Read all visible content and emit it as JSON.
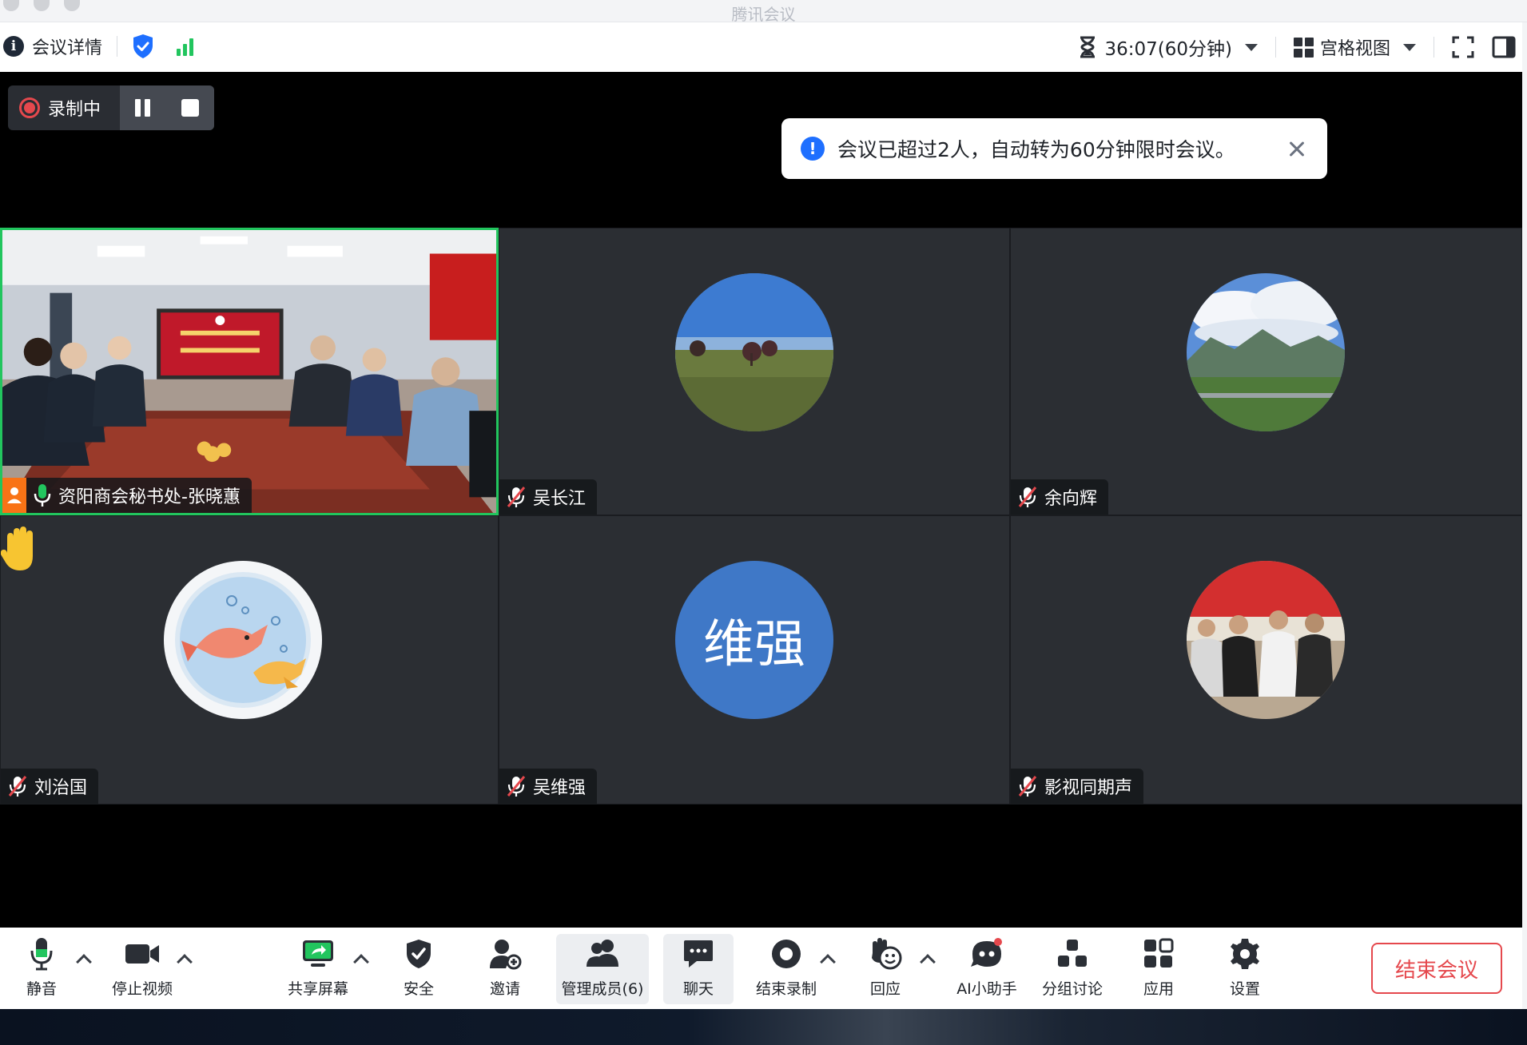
{
  "window": {
    "title": "腾讯会议"
  },
  "infobar": {
    "details_label": "会议详情",
    "timer": "36:07(60分钟)",
    "view_label": "宫格视图"
  },
  "recording": {
    "status_label": "录制中"
  },
  "toast": {
    "message": "会议已超过2人，自动转为60分钟限时会议。"
  },
  "participants": [
    {
      "name": "资阳商会秘书处-张晓蕙",
      "mic": "on",
      "video": "on",
      "active_speaker": true
    },
    {
      "name": "吴长江",
      "mic": "muted",
      "avatar": "lake-landscape-photo"
    },
    {
      "name": "余向辉",
      "mic": "muted",
      "avatar": "mountain-landscape-photo"
    },
    {
      "name": "刘治国",
      "mic": "muted",
      "avatar": "fish-illustration",
      "hand_raised": true
    },
    {
      "name": "吴维强",
      "mic": "muted",
      "avatar_text": "维强"
    },
    {
      "name": "影视同期声",
      "mic": "muted",
      "avatar": "group-photo"
    }
  ],
  "toolbar": {
    "mute_label": "静音",
    "stop_video_label": "停止视频",
    "share_screen_label": "共享屏幕",
    "security_label": "安全",
    "invite_label": "邀请",
    "manage_members_label": "管理成员(6)",
    "chat_label": "聊天",
    "end_recording_label": "结束录制",
    "reactions_label": "回应",
    "ai_assistant_label": "AI小助手",
    "breakout_label": "分组讨论",
    "apps_label": "应用",
    "settings_label": "设置",
    "end_meeting_label": "结束会议"
  },
  "colors": {
    "accent_blue": "#1e6fff",
    "recording_red": "#e5484d",
    "active_green": "#22c55e",
    "avatar_blue": "#3f78c7"
  }
}
